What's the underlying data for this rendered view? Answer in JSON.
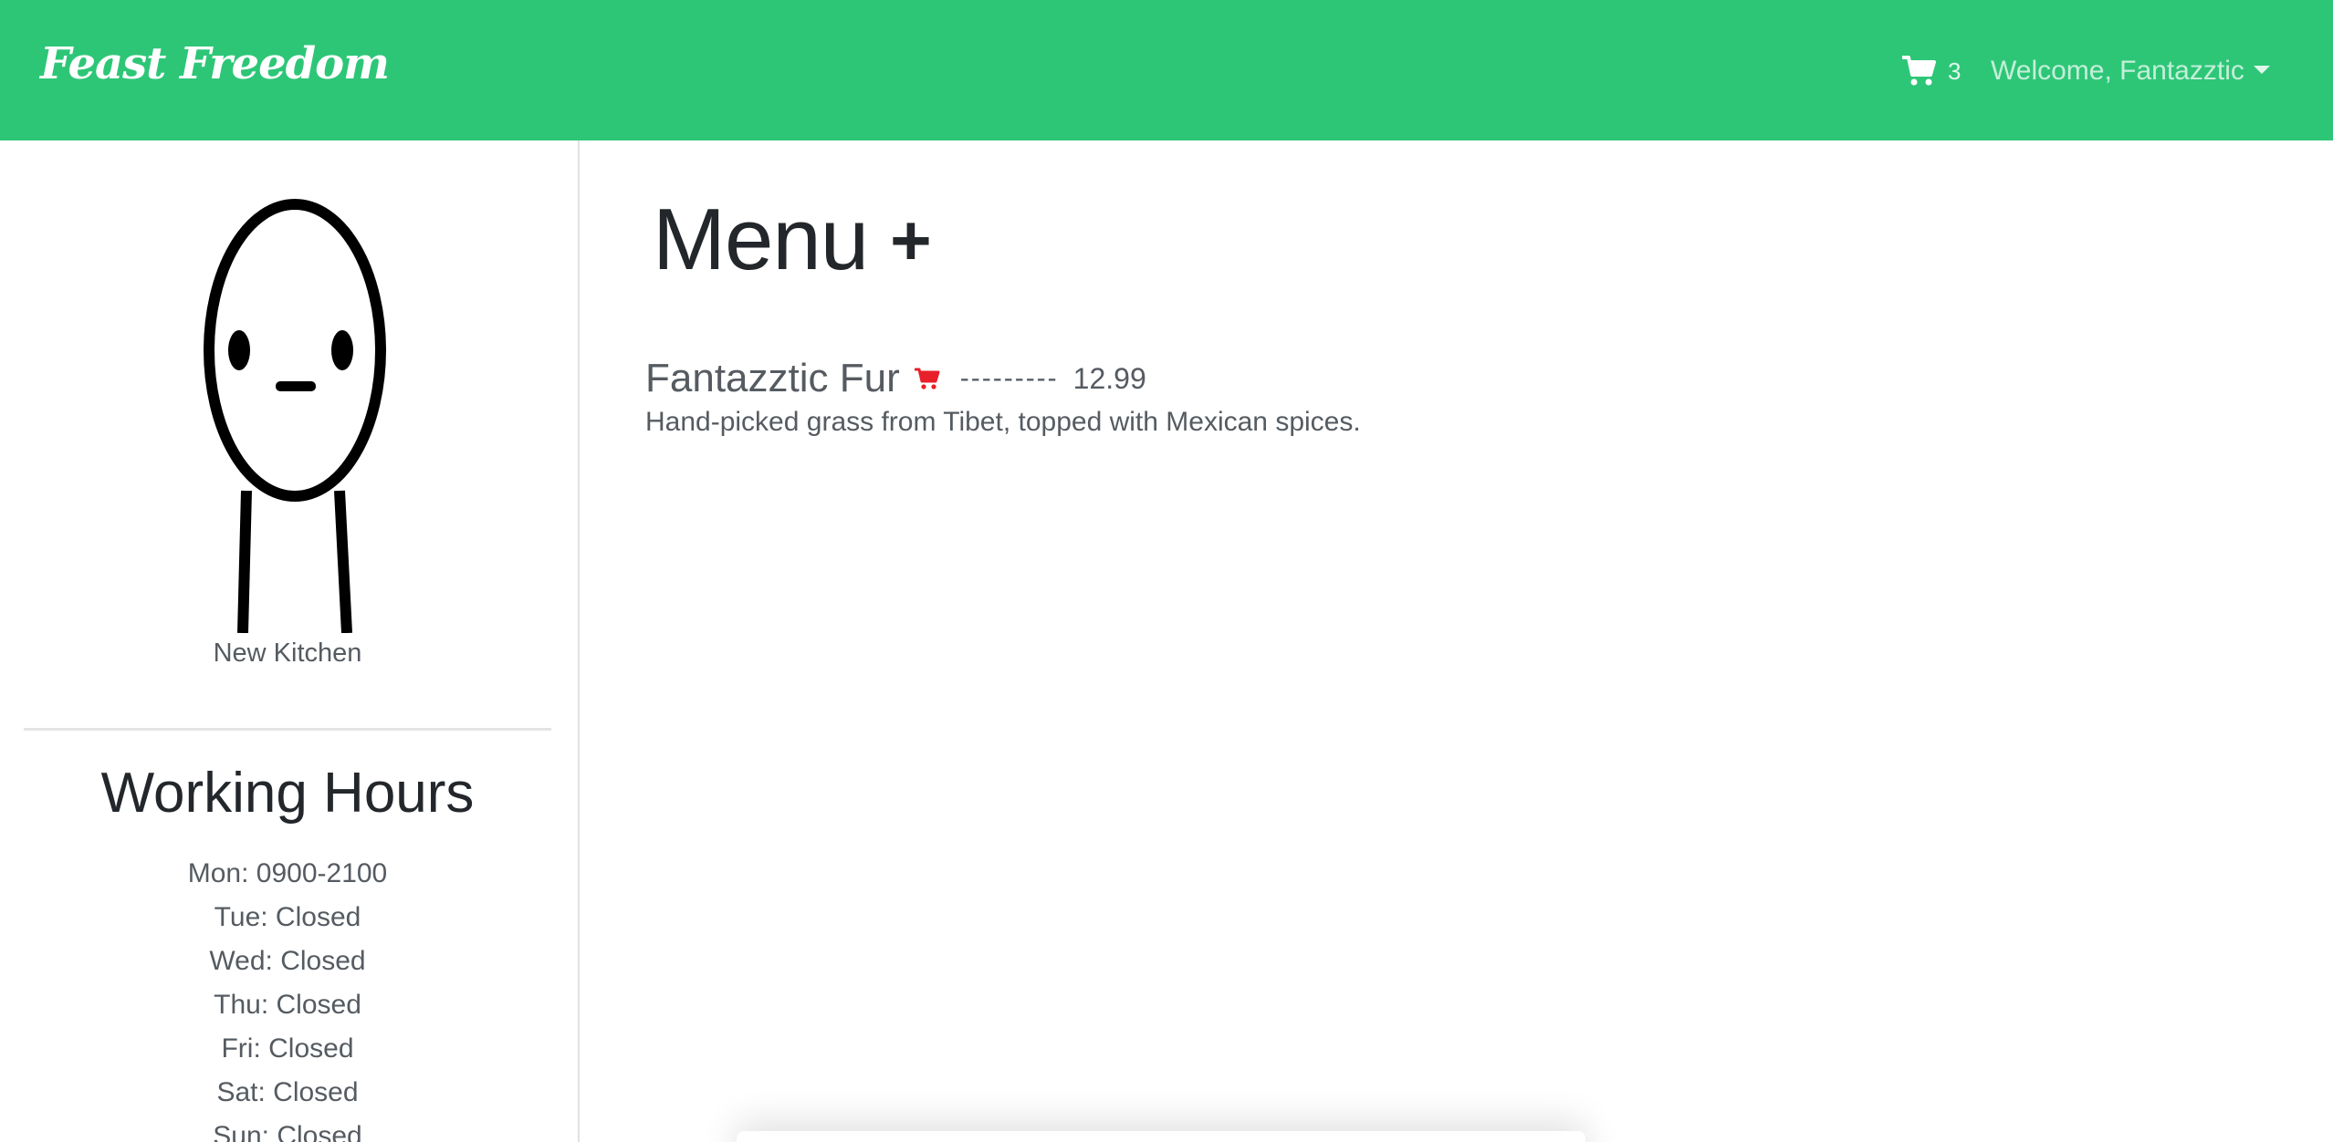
{
  "navbar": {
    "brand": "Feast Freedom",
    "cart_icon": "shopping-cart-icon",
    "cart_count": "3",
    "welcome_text": "Welcome, Fantazztic",
    "dropdown_icon": "caret-down-icon"
  },
  "sidebar": {
    "kitchen_name": "New Kitchen",
    "hours_title": "Working Hours",
    "hours": [
      "Mon: 0900-2100",
      "Tue: Closed",
      "Wed: Closed",
      "Thu: Closed",
      "Fri: Closed",
      "Sat: Closed",
      "Sun: Closed"
    ]
  },
  "main": {
    "title": "Menu",
    "add_symbol": "+",
    "items": [
      {
        "name": "Fantazztic Fur",
        "cart_icon": "add-to-cart-icon",
        "separator": "---------",
        "price": "12.99",
        "description": "Hand-picked grass from Tibet, topped with Mexican spices."
      }
    ]
  },
  "colors": {
    "navbar_bg": "#2dc677",
    "cart_icon_red": "#e8202a",
    "text_dark": "#23272b",
    "text_muted": "#555b61"
  }
}
